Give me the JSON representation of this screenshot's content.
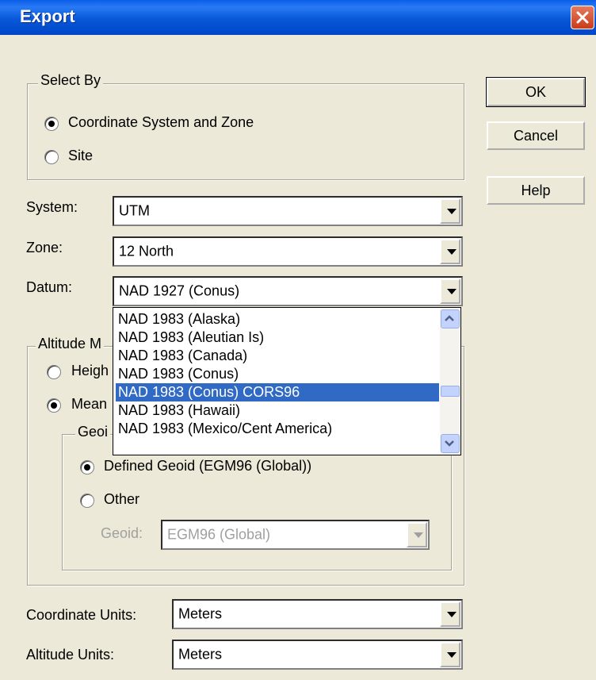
{
  "window": {
    "title": "Export"
  },
  "buttons": {
    "ok": "OK",
    "cancel": "Cancel",
    "help": "Help"
  },
  "select_by": {
    "legend": "Select By",
    "option1": "Coordinate System and Zone",
    "option2": "Site",
    "selected": "Coordinate System and Zone"
  },
  "fields": {
    "system_label": "System:",
    "system_value": "UTM",
    "zone_label": "Zone:",
    "zone_value": "12 North",
    "datum_label": "Datum:",
    "datum_value": "NAD 1927 (Conus)"
  },
  "datum_dropdown": {
    "items": [
      "NAD 1983 (Alaska)",
      "NAD 1983 (Aleutian Is)",
      "NAD 1983 (Canada)",
      "NAD 1983 (Conus)",
      "NAD 1983 (Conus) CORS96",
      "NAD 1983 (Hawaii)",
      "NAD 1983 (Mexico/Cent America)"
    ],
    "selected": "NAD 1983 (Conus) CORS96"
  },
  "altitude": {
    "legend_partial": "Altitude M",
    "height_partial": "Heigh",
    "mean_partial": "Mean",
    "geoid_legend_partial": "Geoi",
    "defined_geoid": "Defined Geoid (EGM96 (Global))",
    "other": "Other",
    "geoid_label": "Geoid:",
    "geoid_value": "EGM96 (Global)"
  },
  "units": {
    "coord_label": "Coordinate Units:",
    "coord_value": "Meters",
    "alt_label": "Altitude Units:",
    "alt_value": "Meters"
  },
  "colors": {
    "title_bar": "#0a5ee8",
    "selection": "#316ac5",
    "dialog_bg": "#ece9d8"
  }
}
